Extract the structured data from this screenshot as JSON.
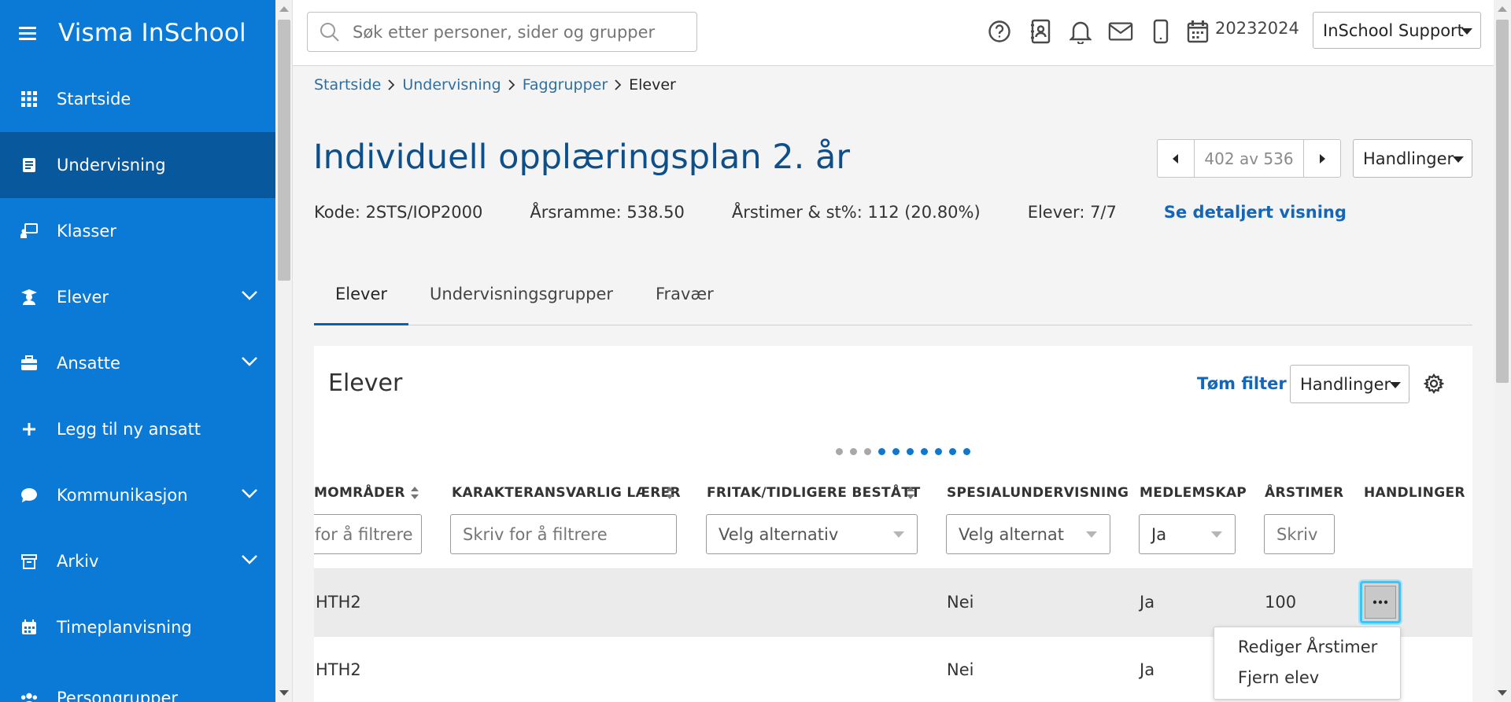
{
  "app": {
    "title": "Visma InSchool"
  },
  "sidebar": {
    "items": [
      {
        "label": "Startside",
        "icon": "grid-icon",
        "expandable": false
      },
      {
        "label": "Undervisning",
        "icon": "book-icon",
        "expandable": false,
        "active": true
      },
      {
        "label": "Klasser",
        "icon": "presentation-icon",
        "expandable": false
      },
      {
        "label": "Elever",
        "icon": "student-icon",
        "expandable": true
      },
      {
        "label": "Ansatte",
        "icon": "briefcase-icon",
        "expandable": true
      },
      {
        "label": "Legg til ny ansatt",
        "icon": "plus-icon",
        "expandable": false
      },
      {
        "label": "Kommunikasjon",
        "icon": "chat-icon",
        "expandable": true
      },
      {
        "label": "Arkiv",
        "icon": "archive-icon",
        "expandable": true
      },
      {
        "label": "Timeplanvisning",
        "icon": "calendar-icon",
        "expandable": false
      },
      {
        "label": "Persongrupper",
        "icon": "people-icon",
        "expandable": false
      }
    ]
  },
  "topbar": {
    "search_placeholder": "Søk etter personer, sider og grupper",
    "school_year": "20232024",
    "user_menu": "InSchool Support",
    "icons": [
      "help-icon",
      "contacts-icon",
      "bell-icon",
      "mail-icon",
      "phone-icon",
      "calendar-icon"
    ]
  },
  "breadcrumb": {
    "items": [
      "Startside",
      "Undervisning",
      "Faggrupper"
    ],
    "current": "Elever"
  },
  "page": {
    "title": "Individuell opplæringsplan 2. år",
    "pager": "402 av 536",
    "actions_label": "Handlinger",
    "meta": {
      "code": "Kode: 2STS/IOP2000",
      "year_frame": "Årsramme: 538.50",
      "hours": "Årstimer & st%: 112 (20.80%)",
      "students": "Elever: 7/7",
      "detail_link": "Se detaljert visning"
    }
  },
  "tabs": [
    {
      "label": "Elever",
      "active": true
    },
    {
      "label": "Undervisningsgrupper",
      "active": false
    },
    {
      "label": "Fravær",
      "active": false
    }
  ],
  "card": {
    "title": "Elever",
    "clear_filter": "Tøm filter",
    "actions_label": "Handlinger",
    "scroll_position": {
      "current": 3,
      "total": 10
    },
    "columns": [
      {
        "header": "MOMRÅDER",
        "filter": "for å filtrere",
        "filter_type": "text",
        "sortable": true
      },
      {
        "header": "KARAKTERANSVARLIG LÆRER",
        "filter": "Skriv for å filtrere",
        "filter_type": "text",
        "sortable": true
      },
      {
        "header": "FRITAK/TIDLIGERE BESTÅTT",
        "filter": "Velg alternativ",
        "filter_type": "select",
        "sortable": true
      },
      {
        "header": "SPESIALUNDERVISNING",
        "filter": "Velg alternat",
        "filter_type": "select",
        "sortable": false
      },
      {
        "header": "MEDLEMSKAP",
        "filter": "Ja",
        "filter_type": "select",
        "sortable": false
      },
      {
        "header": "ÅRSTIMER",
        "filter": "Skriv",
        "filter_type": "text",
        "sortable": false
      },
      {
        "header": "HANDLINGER",
        "filter": "",
        "filter_type": "none",
        "sortable": false
      }
    ],
    "rows": [
      {
        "omrader": "HTH2",
        "larer": "",
        "fritak": "",
        "spesial": "Nei",
        "medlemskap": "Ja",
        "arstimer": "100"
      },
      {
        "omrader": "HTH2",
        "larer": "",
        "fritak": "",
        "spesial": "Nei",
        "medlemskap": "Ja",
        "arstimer": ""
      }
    ]
  },
  "context_menu": {
    "items": [
      "Rediger Årstimer",
      "Fjern elev"
    ]
  },
  "colors": {
    "sidebar_bg": "#0a7ad6",
    "sidebar_active": "#07589d",
    "title_blue": "#0d4f8a",
    "link_blue": "#1366b8",
    "focus_ring": "#3fc3f4"
  }
}
